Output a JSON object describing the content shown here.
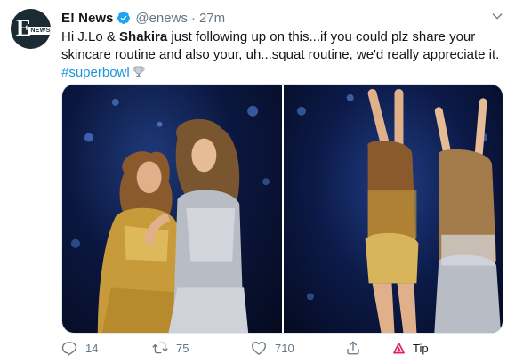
{
  "tweet": {
    "author_name": "E! News",
    "handle": "@enews",
    "separator": "·",
    "time": "27m",
    "avatar_text_e": "E",
    "avatar_text_news": "NEWS",
    "text_part1": "Hi J.Lo & ",
    "text_bold": "Shakira",
    "text_part2": " just following up on this...if you could plz share your skincare routine and also your, uh...squat routine, we'd really appreciate it.",
    "hashtag": "#superbowl",
    "hashtag_emoji_icon": "trophy-icon"
  },
  "media": {
    "photo_count": 2
  },
  "actions": {
    "reply_count": "14",
    "retweet_count": "75",
    "like_count": "710",
    "tip_label": "Tip"
  },
  "colors": {
    "link": "#1b95e0",
    "secondary_text": "#657786",
    "verified": "#1da1f2",
    "tip_icon": "#e0245e"
  }
}
